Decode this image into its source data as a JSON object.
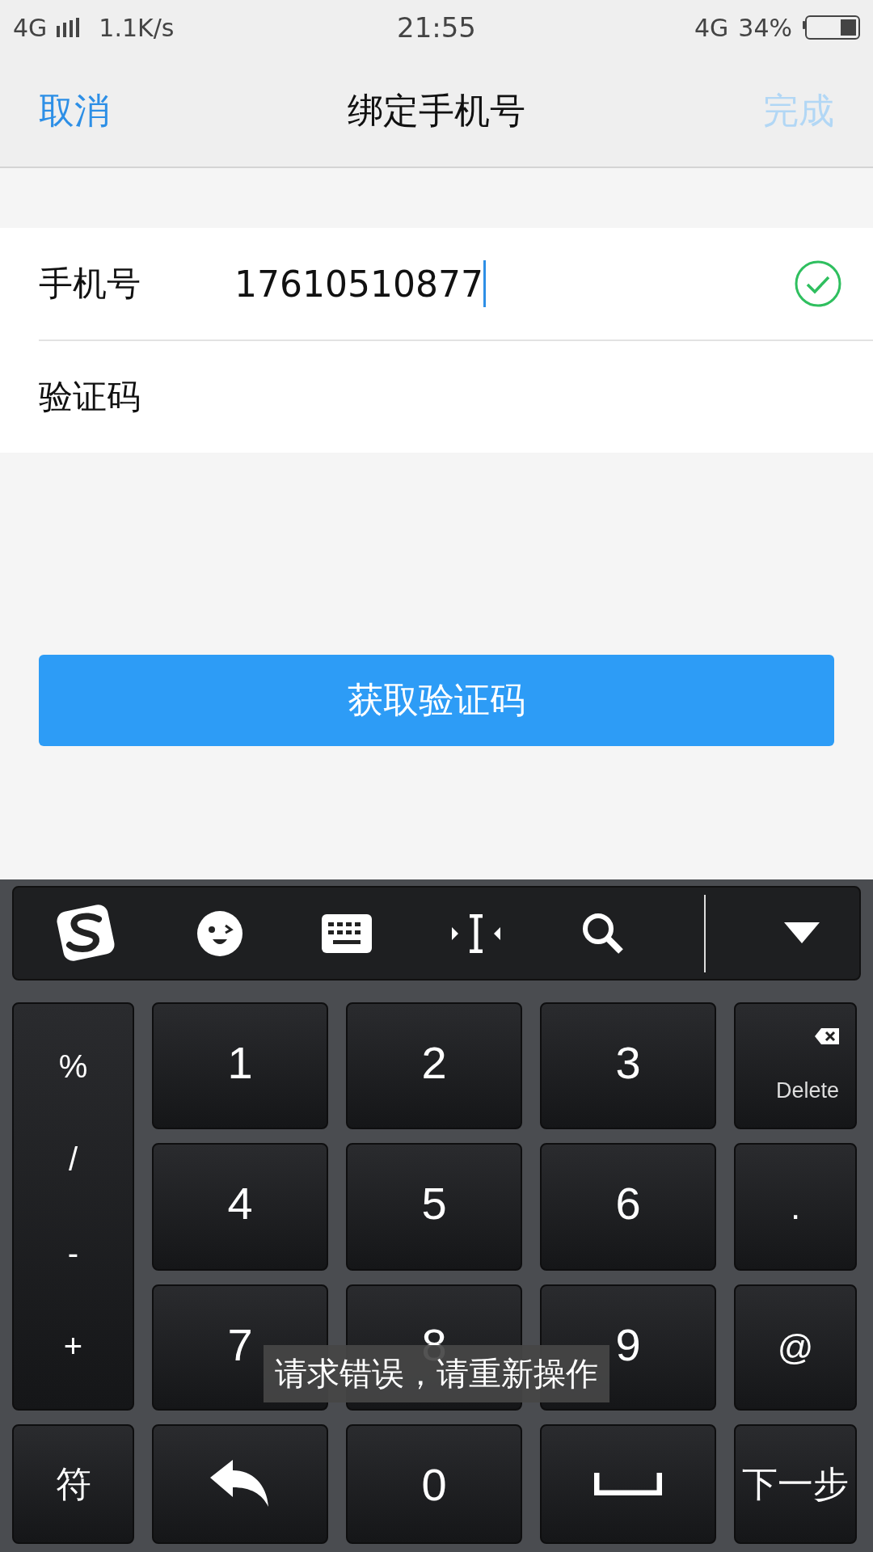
{
  "status_bar": {
    "network": "4G",
    "speed": "1.1K/s",
    "time": "21:55",
    "network_right": "4G",
    "battery": "34%"
  },
  "nav": {
    "cancel": "取消",
    "title": "绑定手机号",
    "done": {
      "label": "完成",
      "disabled": true
    }
  },
  "fields": [
    {
      "label": "手机号",
      "value": "17610510877",
      "focused": true,
      "valid": true
    },
    {
      "label": "验证码",
      "focused": false,
      "valid": false
    }
  ],
  "action_button": "获取验证码",
  "keyboard": {
    "symbols": [
      "%",
      "/",
      "-",
      "+"
    ],
    "keys": [
      {
        "kind": "digit",
        "label": "1"
      },
      {
        "kind": "digit",
        "label": "2"
      },
      {
        "kind": "digit",
        "label": "3"
      },
      {
        "kind": "delete",
        "label": "Delete"
      },
      {
        "kind": "digit",
        "label": "4"
      },
      {
        "kind": "digit",
        "label": "5"
      },
      {
        "kind": "digit",
        "label": "6"
      },
      {
        "kind": "symbol",
        "label": "."
      },
      {
        "kind": "digit",
        "label": "7"
      },
      {
        "kind": "digit",
        "label": "8"
      },
      {
        "kind": "digit",
        "label": "9"
      },
      {
        "kind": "symbol",
        "label": "@"
      },
      {
        "kind": "text",
        "label": "符"
      },
      {
        "kind": "undo"
      },
      {
        "kind": "digit",
        "label": "0"
      },
      {
        "kind": "space"
      },
      {
        "kind": "text",
        "label": "下一步"
      }
    ]
  },
  "toast": "请求错误，请重新操作"
}
